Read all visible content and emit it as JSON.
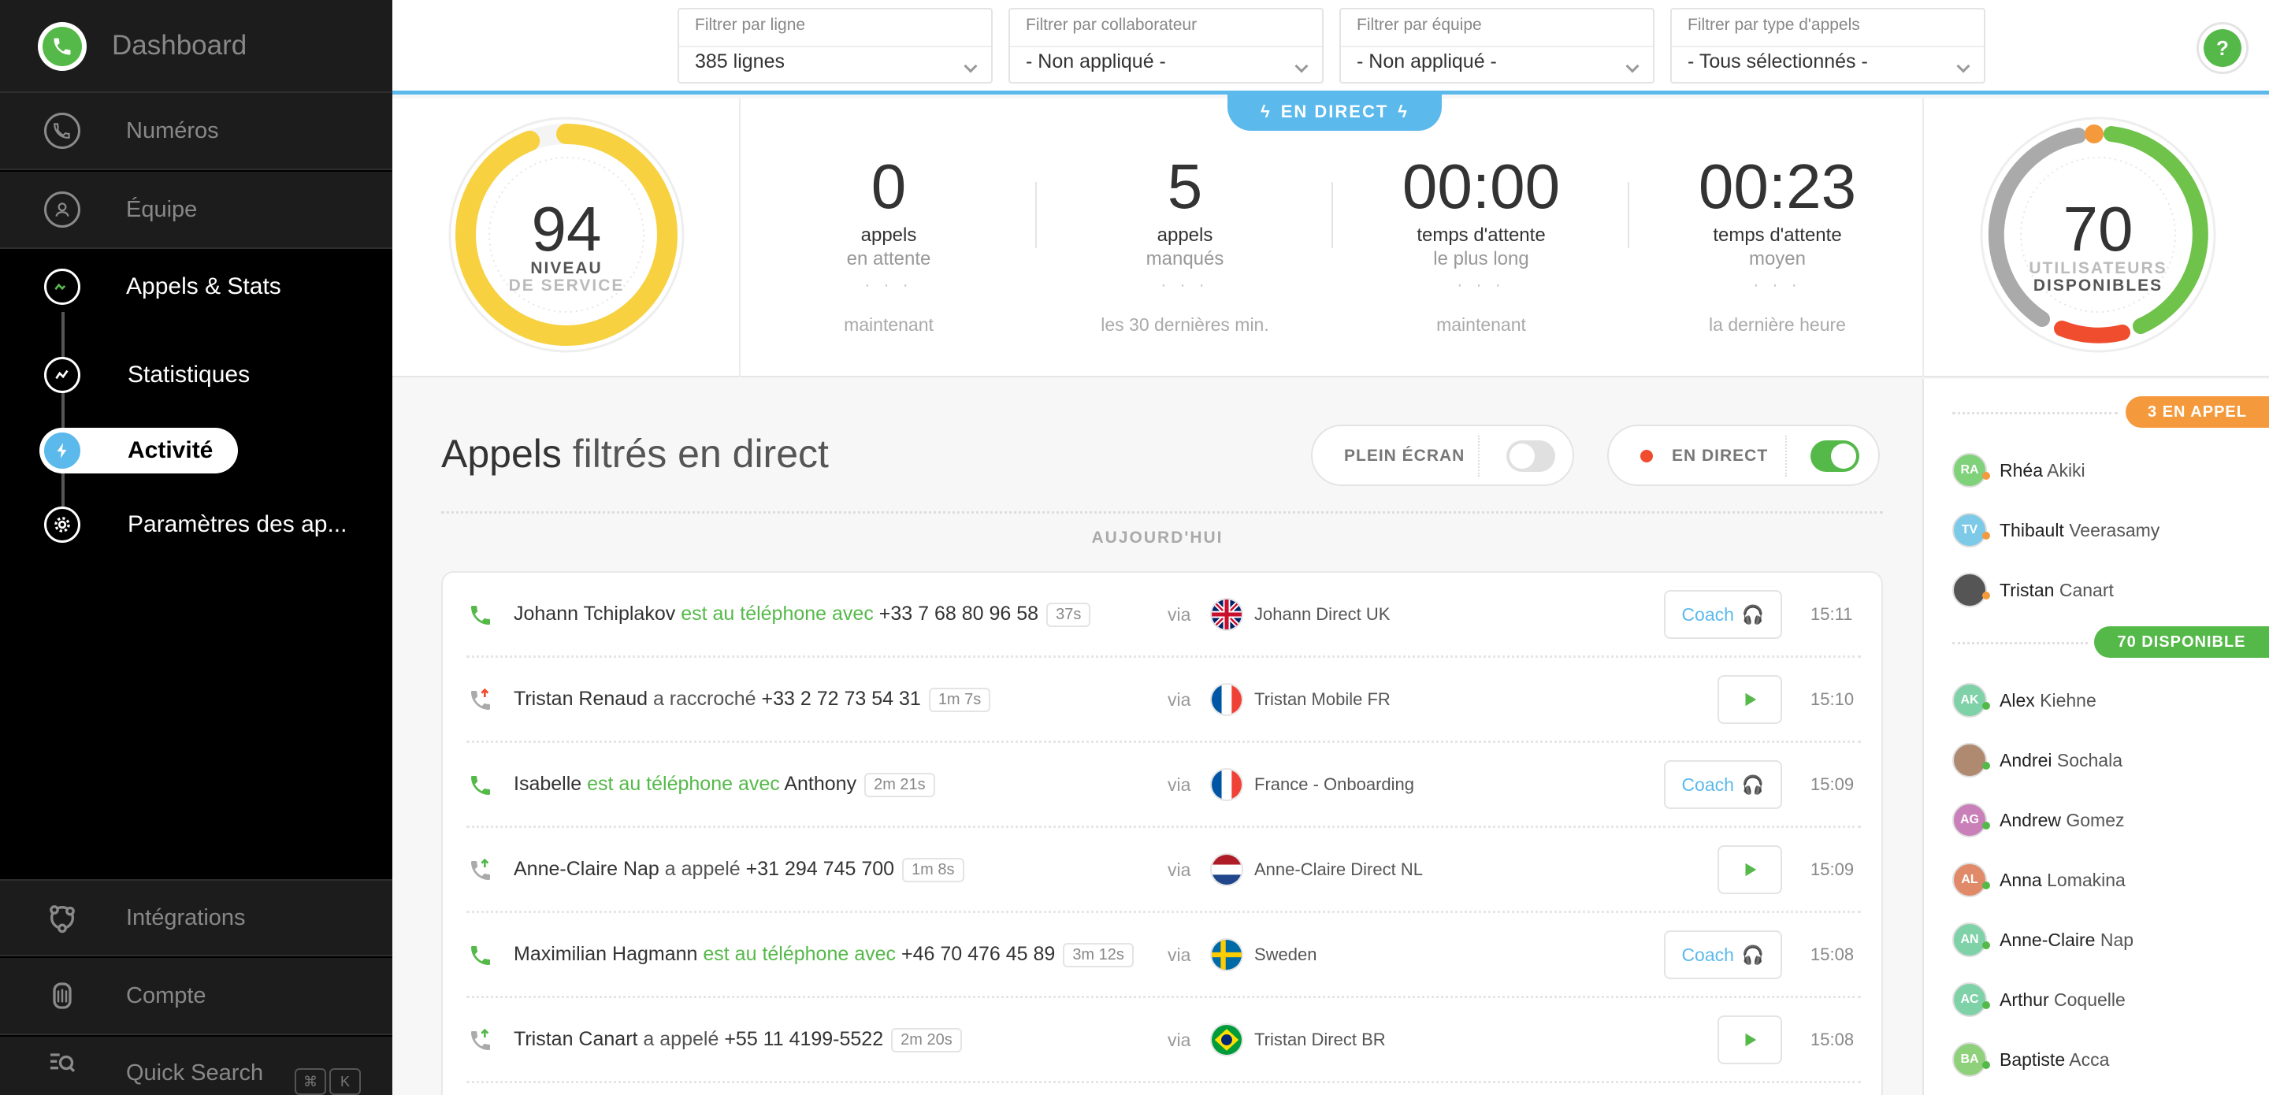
{
  "app": {
    "title": "Dashboard"
  },
  "colors": {
    "accent_green": "#55b949",
    "accent_blue": "#5bb9ec",
    "accent_orange": "#f59a3c",
    "service_yellow": "#f7d140",
    "missed_red": "#ef4d2e"
  },
  "sidebar": {
    "items": [
      {
        "label": "Numéros",
        "icon": "phone-icon"
      },
      {
        "label": "Équipe",
        "icon": "user-icon"
      },
      {
        "label": "Appels & Stats",
        "icon": "stats-icon"
      },
      {
        "label": "Statistiques",
        "icon": "chart-icon"
      },
      {
        "label": "Activité",
        "icon": "lightning-icon"
      },
      {
        "label": "Paramètres des ap...",
        "icon": "gear-icon"
      },
      {
        "label": "Intégrations",
        "icon": "integrations-icon"
      },
      {
        "label": "Compte",
        "icon": "account-icon"
      },
      {
        "label": "Quick Search",
        "icon": "search-icon"
      }
    ],
    "shortcut": [
      "⌘",
      "K"
    ]
  },
  "filters": [
    {
      "label": "Filtrer par ligne",
      "value": "385 lignes"
    },
    {
      "label": "Filtrer par collaborateur",
      "value": "- Non appliqué -"
    },
    {
      "label": "Filtrer par équipe",
      "value": "- Non appliqué -"
    },
    {
      "label": "Filtrer par type d'appels",
      "value": "- Tous sélectionnés -"
    }
  ],
  "live_badge": "EN DIRECT",
  "service_level": {
    "value": "94",
    "label1": "NIVEAU",
    "label2": "DE SERVICE",
    "fraction": 0.94
  },
  "stats": [
    {
      "value": "0",
      "label1": "appels",
      "label2": "en attente",
      "dots": "· · ·",
      "period": "maintenant"
    },
    {
      "value": "5",
      "label1": "appels",
      "label2": "manqués",
      "dots": "· · ·",
      "period": "les 30 dernières min."
    },
    {
      "value": "00:00",
      "label1": "temps d'attente",
      "label2": "le plus long",
      "dots": "· · ·",
      "period": "maintenant"
    },
    {
      "value": "00:23",
      "label1": "temps d'attente",
      "label2": "moyen",
      "dots": "· · ·",
      "period": "la dernière heure"
    }
  ],
  "users_gauge": {
    "value": "70",
    "label1": "UTILISATEURS",
    "label2": "DISPONIBLES"
  },
  "main": {
    "title_bold": "Appels",
    "title_rest": " filtrés en direct",
    "fullscreen_label": "PLEIN ÉCRAN",
    "live_label": "EN DIRECT",
    "today": "AUJOURD'HUI"
  },
  "calls": [
    {
      "type": "live",
      "name": "Johann Tchiplakov",
      "action": "est au téléphone avec",
      "target": "+33 7 68 80 96 58",
      "duration": "37s",
      "via": "via",
      "flag": "uk",
      "line": "Johann Direct UK",
      "button": "Coach",
      "time": "15:11"
    },
    {
      "type": "hangup",
      "name": "Tristan Renaud",
      "action": "a raccroché",
      "target": "+33 2 72 73 54 31",
      "duration": "1m 7s",
      "via": "via",
      "flag": "fr",
      "line": "Tristan Mobile FR",
      "button": "play",
      "time": "15:10"
    },
    {
      "type": "live",
      "name": "Isabelle",
      "action": "est au téléphone avec",
      "target": "Anthony",
      "duration": "2m 21s",
      "via": "via",
      "flag": "fr",
      "line": "France - Onboarding",
      "button": "Coach",
      "time": "15:09"
    },
    {
      "type": "out",
      "name": "Anne-Claire Nap",
      "action": "a appelé",
      "target": "+31 294 745 700",
      "duration": "1m 8s",
      "via": "via",
      "flag": "nl",
      "line": "Anne-Claire Direct NL",
      "button": "play",
      "time": "15:09"
    },
    {
      "type": "live",
      "name": "Maximilian Hagmann",
      "action": "est au téléphone avec",
      "target": "+46 70 476 45 89",
      "duration": "3m 12s",
      "via": "via",
      "flag": "se",
      "line": "Sweden",
      "button": "Coach",
      "time": "15:08"
    },
    {
      "type": "out",
      "name": "Tristan Canart",
      "action": "a appelé",
      "target": "+55 11 4199-5522",
      "duration": "2m 20s",
      "via": "via",
      "flag": "br",
      "line": "Tristan Direct BR",
      "button": "play",
      "time": "15:08"
    }
  ],
  "right_panel": {
    "in_call_badge": "3 EN APPEL",
    "available_badge": "70 DISPONIBLE",
    "in_call": [
      {
        "initials": "RA",
        "first": "Rhéa",
        "last": "Akiki",
        "color": "#7fd17a"
      },
      {
        "initials": "TV",
        "first": "Thibault",
        "last": "Veerasamy",
        "color": "#7cc9e8"
      },
      {
        "initials": "",
        "first": "Tristan",
        "last": "Canart",
        "color": "#555555"
      }
    ],
    "available": [
      {
        "initials": "AK",
        "first": "Alex",
        "last": "Kiehne",
        "color": "#7fd1a8"
      },
      {
        "initials": "",
        "first": "Andrei",
        "last": "Sochala",
        "color": "#b08a70"
      },
      {
        "initials": "AG",
        "first": "Andrew",
        "last": "Gomez",
        "color": "#c97fb8"
      },
      {
        "initials": "AL",
        "first": "Anna",
        "last": "Lomakina",
        "color": "#e08a6a"
      },
      {
        "initials": "AN",
        "first": "Anne-Claire",
        "last": "Nap",
        "color": "#7fd1a8"
      },
      {
        "initials": "AC",
        "first": "Arthur",
        "last": "Coquelle",
        "color": "#7fd1a8"
      },
      {
        "initials": "BA",
        "first": "Baptiste",
        "last": "Acca",
        "color": "#8fd17a"
      }
    ]
  }
}
